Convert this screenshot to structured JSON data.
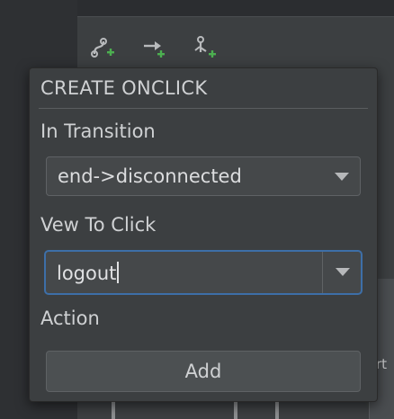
{
  "popup": {
    "title": "CREATE ONCLICK",
    "transition_label": "In Transition",
    "transition_value": "end->disconnected",
    "view_label": "Vew To Click",
    "view_value": "logout",
    "action_label": "Action",
    "add_label": "Add"
  },
  "background": {
    "partial_text": "rt"
  },
  "toolbar": {
    "icons": [
      "create-transition-icon",
      "create-onclick-icon",
      "create-onswipe-icon"
    ]
  },
  "colors": {
    "accent_green": "#4caf50",
    "focus_border": "#3d6fa8",
    "popup_bg": "#3c3f41"
  }
}
